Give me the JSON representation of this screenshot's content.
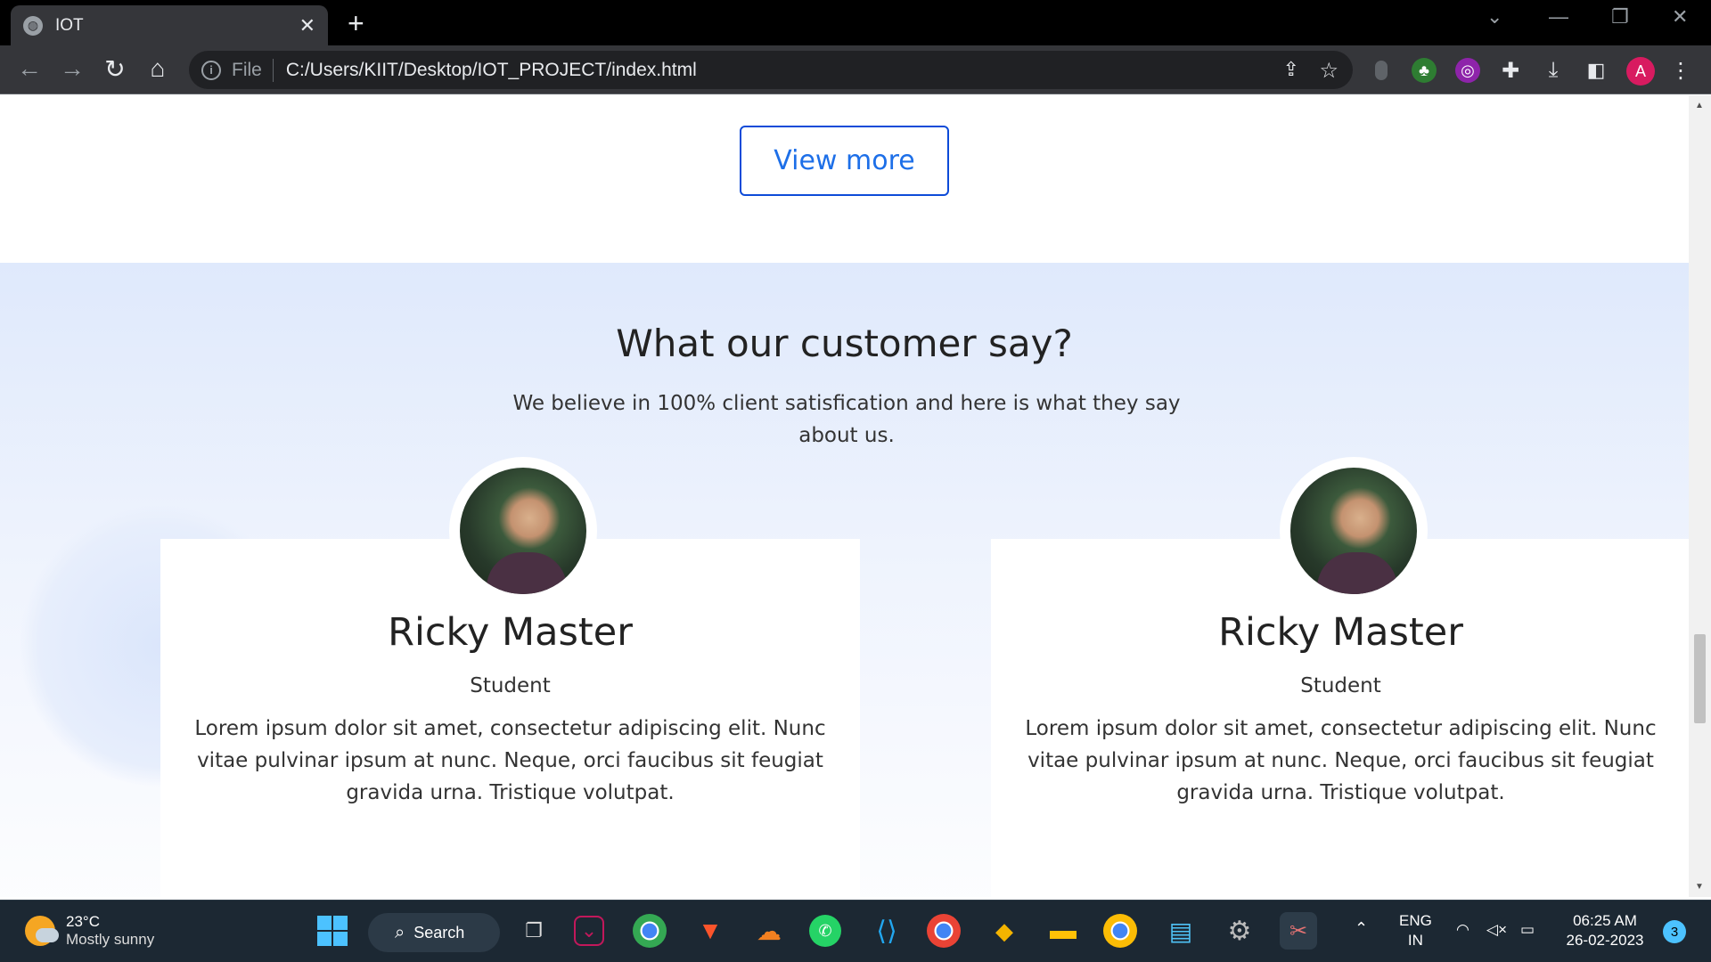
{
  "browser": {
    "tab_title": "IOT",
    "tab_close": "✕",
    "new_tab": "+",
    "address_prefix": "File",
    "address": "C:/Users/KIIT/Desktop/IOT_PROJECT/index.html",
    "profile_initial": "A"
  },
  "page": {
    "view_more_label": "View more",
    "heading": "What our customer say?",
    "subheading": "We believe in 100% client satisfication and here is what they say about us.",
    "testimonials": [
      {
        "name": "Ricky Master",
        "role": "Student",
        "text": "Lorem ipsum dolor sit amet, consectetur adipiscing elit. Nunc vitae pulvinar ipsum at nunc. Neque, orci faucibus sit feugiat gravida urna. Tristique volutpat."
      },
      {
        "name": "Ricky Master",
        "role": "Student",
        "text": "Lorem ipsum dolor sit amet, consectetur adipiscing elit. Nunc vitae pulvinar ipsum at nunc. Neque, orci faucibus sit feugiat gravida urna. Tristique volutpat."
      }
    ]
  },
  "taskbar": {
    "weather_temp": "23°C",
    "weather_desc": "Mostly sunny",
    "search_label": "Search",
    "lang_top": "ENG",
    "lang_bottom": "IN",
    "time": "06:25 AM",
    "date": "26-02-2023",
    "notification_count": "3"
  },
  "colors": {
    "accent_blue": "#1d6fe8",
    "button_border": "#0d4bd8",
    "section_bg": "#dfe9fc"
  }
}
